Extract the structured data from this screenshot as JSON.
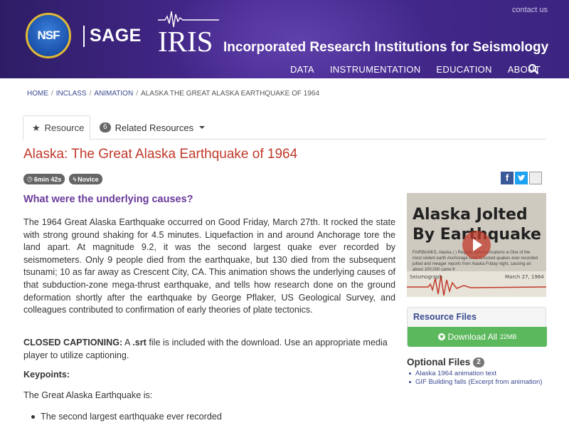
{
  "header": {
    "nsf_logo": "NSF",
    "sage_label": "SAGE",
    "iris_logo": "IRIS",
    "org_name": "Incorporated Research Institutions for Seismology",
    "contact": "contact us",
    "nav": [
      "DATA",
      "INSTRUMENTATION",
      "EDUCATION",
      "ABOUT"
    ],
    "search_icon": "search-icon"
  },
  "breadcrumb": [
    "HOME",
    "INCLASS",
    "ANIMATION",
    "ALASKA THE GREAT ALASKA EARTHQUAKE OF 1964"
  ],
  "tabs": {
    "resource": "Resource",
    "related_count": "6",
    "related": "Related Resources"
  },
  "page": {
    "title": "Alaska: The Great Alaska Earthquake of 1964",
    "duration": "6min 42s",
    "level": "Novice",
    "question": "What were the underlying causes?",
    "paragraph": "The 1964 Great Alaska Earthquake occurred on Good Friday, March 27th. It rocked the state with strong ground shaking for 4.5 minutes. Liquefaction in and around Anchorage tore the land apart. At magnitude 9.2, it was the second largest quake ever recorded by seismometers. Only 9 people died from the earthquake, but 130 died from the subsequent tsunami; 10 as far away as Crescent City, CA. This animation shows the underlying causes of that subduction-zone mega-thrust earthquake, and tells how research done on the ground deformation shortly after the earthquake by George Pflaker, US Geological Survey, and colleagues contributed to confirmation of early theories of plate tectonics.",
    "cc_label": "CLOSED CAPTIONING:",
    "cc_a": "A",
    "cc_srt": ".srt",
    "cc_rest": "file is included with the download. Use an appropriate media player to utilize captioning.",
    "keypoints": "Keypoints:",
    "gae_is": "The Great Alaska Earthquake is:",
    "list": [
      "The second largest earthquake ever recorded"
    ]
  },
  "video": {
    "headline1": "Alaska Jolted",
    "headline2": "By Earthquake",
    "snippet": "FAIRBANKS, Alaska (   ) Regular communications w One of the most violent earth Anchorage were knocked quakes ever recorded jolted and meager reports from Alaska Friday night, causing an about 100,000 came fr",
    "caption_left": "Seismograph",
    "caption_right": "March 27, 1964"
  },
  "resource_files": {
    "title": "Resource Files",
    "download": "Download All",
    "size": "22MB"
  },
  "optional_files": {
    "title": "Optional Files",
    "count": "2",
    "items": [
      "Alaska 1964 animation text",
      "GIF Building falls (Excerpt from animation)"
    ]
  },
  "colors": {
    "header_purple": "#3b2580",
    "title_red": "#c0392b",
    "question_purple": "#6a3a9a",
    "download_green": "#5cb85c"
  }
}
